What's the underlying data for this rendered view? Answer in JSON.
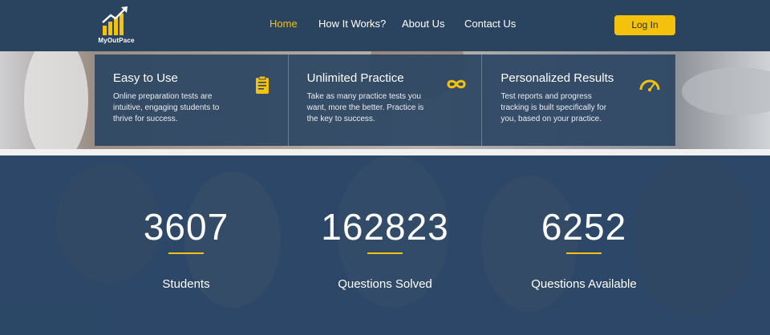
{
  "brand": {
    "name": "MyOutPace",
    "accent": "#f4c20d",
    "nav_bg": "#2a4460"
  },
  "nav": {
    "links": [
      {
        "label": "Home",
        "active": true
      },
      {
        "label": "How It Works?",
        "active": false
      },
      {
        "label": "About Us",
        "active": false
      },
      {
        "label": "Contact Us",
        "active": false
      }
    ],
    "login_label": "Log In"
  },
  "features": [
    {
      "title": "Easy to Use",
      "text": "Online preparation tests are intuitive, engaging students to thrive for success.",
      "icon": "clipboard-icon"
    },
    {
      "title": "Unlimited Practice",
      "text": "Take as many practice tests you want, more the better. Practice is the key to success.",
      "icon": "infinity-icon"
    },
    {
      "title": "Personalized Results",
      "text": "Test reports and progress tracking is built specifically for you, based on your practice.",
      "icon": "speedometer-icon"
    }
  ],
  "stats": [
    {
      "value": "3607",
      "label": "Students"
    },
    {
      "value": "162823",
      "label": "Questions Solved"
    },
    {
      "value": "6252",
      "label": "Questions Available"
    }
  ]
}
